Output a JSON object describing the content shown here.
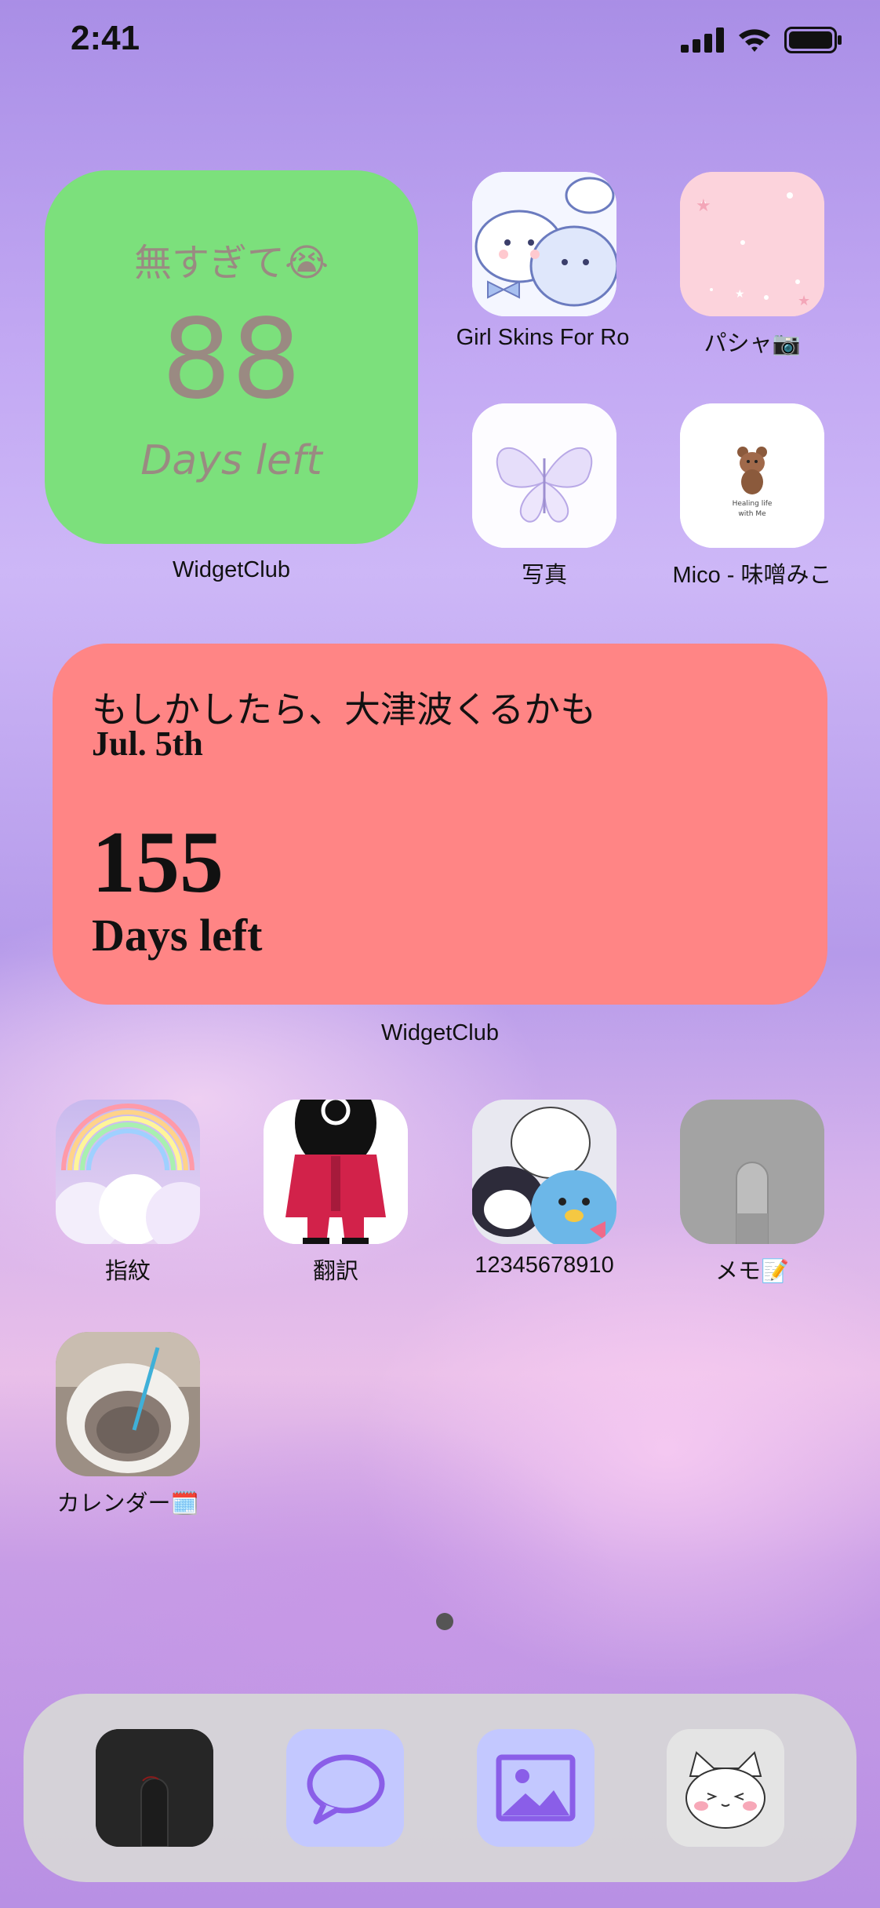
{
  "status_bar": {
    "time": "2:41"
  },
  "widget_top": {
    "title": "無すぎて😭",
    "count": "88",
    "caption": "Days left",
    "label": "WidgetClub"
  },
  "apps_top": [
    {
      "label": "Girl Skins For Ro"
    },
    {
      "label": "パシャ📷"
    },
    {
      "label": "写真"
    },
    {
      "label": "Mico - 味噌みこ"
    }
  ],
  "mico_icon_text": [
    "Healing life",
    "with Me"
  ],
  "widget_red": {
    "line1": "もしかしたら、大津波くるかも",
    "date": "Jul. 5th",
    "count": "155",
    "caption": "Days left",
    "label": "WidgetClub"
  },
  "apps_row3": [
    {
      "label": "指紋"
    },
    {
      "label": "翻訳"
    },
    {
      "label": "12345678910"
    },
    {
      "label": "メモ📝"
    }
  ],
  "apps_row4": [
    {
      "label": "カレンダー🗓️"
    }
  ],
  "colors": {
    "green_widget": "#7ce07c",
    "red_widget": "#ff8585",
    "dock": "#d7d7d7"
  }
}
